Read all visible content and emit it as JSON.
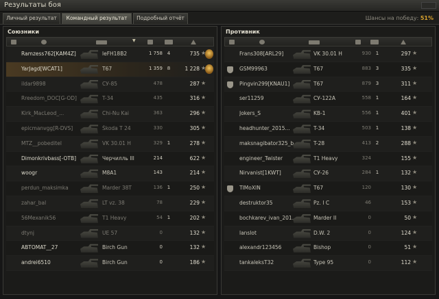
{
  "window": {
    "title": "Результаты боя"
  },
  "tabs": [
    {
      "label": "Личный результат",
      "active": false
    },
    {
      "label": "Командный результат",
      "active": true
    },
    {
      "label": "Подробный отчёт",
      "active": false
    }
  ],
  "win_chance": {
    "label": "Шансы на победу:",
    "value": "51%"
  },
  "allies": {
    "title": "Союзники",
    "rows": [
      {
        "name": "Ramzess762[KAM4Z]",
        "tank": "leFH18B2",
        "damage": "1 758",
        "kills": "4",
        "xp": "735",
        "medal": true,
        "alive": true,
        "me": false,
        "squad": false
      },
      {
        "name": "YarJagd[WCAT1]",
        "tank": "T67",
        "damage": "1 359",
        "kills": "8",
        "xp": "1 228",
        "medal": true,
        "alive": true,
        "me": true,
        "squad": false
      },
      {
        "name": "ildar9898",
        "tank": "СУ-85",
        "damage": "478",
        "kills": "",
        "xp": "287",
        "medal": false,
        "alive": false,
        "me": false,
        "squad": false
      },
      {
        "name": "Rreedom_DOC[G-OD]",
        "tank": "T-34",
        "damage": "435",
        "kills": "",
        "xp": "316",
        "medal": false,
        "alive": false,
        "me": false,
        "squad": false
      },
      {
        "name": "Kirk_MacLeod_...",
        "tank": "Chi-Nu Kai",
        "damage": "363",
        "kills": "",
        "xp": "296",
        "medal": false,
        "alive": false,
        "me": false,
        "squad": false
      },
      {
        "name": "epicmanvgg[R-DVS]",
        "tank": "Škoda T 24",
        "damage": "330",
        "kills": "",
        "xp": "305",
        "medal": false,
        "alive": false,
        "me": false,
        "squad": false
      },
      {
        "name": "MTZ__pobeditel",
        "tank": "VK 30.01 H",
        "damage": "329",
        "kills": "1",
        "xp": "278",
        "medal": false,
        "alive": false,
        "me": false,
        "squad": false
      },
      {
        "name": "Dimonkrivbass[-OTB]",
        "tank": "Черчилль III",
        "damage": "214",
        "kills": "",
        "xp": "622",
        "medal": false,
        "alive": true,
        "me": false,
        "squad": false
      },
      {
        "name": "woogr",
        "tank": "M8A1",
        "damage": "143",
        "kills": "",
        "xp": "214",
        "medal": false,
        "alive": true,
        "me": false,
        "squad": false
      },
      {
        "name": "perdun_maksimka",
        "tank": "Marder 38T",
        "damage": "136",
        "kills": "1",
        "xp": "250",
        "medal": false,
        "alive": false,
        "me": false,
        "squad": false
      },
      {
        "name": "zahar_bal",
        "tank": "LT vz. 38",
        "damage": "78",
        "kills": "",
        "xp": "229",
        "medal": false,
        "alive": false,
        "me": false,
        "squad": false
      },
      {
        "name": "56Mexanik56",
        "tank": "T1 Heavy",
        "damage": "54",
        "kills": "1",
        "xp": "202",
        "medal": false,
        "alive": false,
        "me": false,
        "squad": false
      },
      {
        "name": "dtynj",
        "tank": "UE 57",
        "damage": "0",
        "kills": "",
        "xp": "132",
        "medal": false,
        "alive": false,
        "me": false,
        "squad": false
      },
      {
        "name": "ABTOMAT__27",
        "tank": "Birch Gun",
        "damage": "0",
        "kills": "",
        "xp": "132",
        "medal": false,
        "alive": true,
        "me": false,
        "squad": false
      },
      {
        "name": "andrei6510",
        "tank": "Birch Gun",
        "damage": "0",
        "kills": "",
        "xp": "186",
        "medal": false,
        "alive": true,
        "me": false,
        "squad": false
      }
    ]
  },
  "enemies": {
    "title": "Противник",
    "rows": [
      {
        "name": "Frans308[ARL29]",
        "tank": "VK 30.01 H",
        "damage": "930",
        "kills": "1",
        "xp": "297",
        "squad": false
      },
      {
        "name": "GSM99963",
        "tank": "T67",
        "damage": "883",
        "kills": "3",
        "xp": "335",
        "squad": true
      },
      {
        "name": "Pingvin299[KNAU1]",
        "tank": "T67",
        "damage": "879",
        "kills": "3",
        "xp": "311",
        "squad": true
      },
      {
        "name": "ser11259",
        "tank": "СУ-122А",
        "damage": "558",
        "kills": "1",
        "xp": "164",
        "squad": false
      },
      {
        "name": "Jokers_S",
        "tank": "KB-1",
        "damage": "556",
        "kills": "1",
        "xp": "401",
        "squad": false
      },
      {
        "name": "headhunter_2015...",
        "tank": "T-34",
        "damage": "503",
        "kills": "1",
        "xp": "138",
        "squad": false
      },
      {
        "name": "maksnagibator325_b...",
        "tank": "T-28",
        "damage": "413",
        "kills": "2",
        "xp": "288",
        "squad": false
      },
      {
        "name": "engineer_Twister",
        "tank": "T1 Heavy",
        "damage": "324",
        "kills": "",
        "xp": "155",
        "squad": false
      },
      {
        "name": "Nirvanist[1KWT]",
        "tank": "СУ-26",
        "damage": "284",
        "kills": "1",
        "xp": "132",
        "squad": false
      },
      {
        "name": "TIMoXIN",
        "tank": "T67",
        "damage": "120",
        "kills": "",
        "xp": "130",
        "squad": true
      },
      {
        "name": "destruktor35",
        "tank": "Pz. I C",
        "damage": "46",
        "kills": "",
        "xp": "153",
        "squad": false
      },
      {
        "name": "bochkarev_ivan_201...",
        "tank": "Marder II",
        "damage": "0",
        "kills": "",
        "xp": "50",
        "squad": false
      },
      {
        "name": "lanslot",
        "tank": "D.W. 2",
        "damage": "0",
        "kills": "",
        "xp": "124",
        "squad": false
      },
      {
        "name": "alexandr123456",
        "tank": "Bishop",
        "damage": "0",
        "kills": "",
        "xp": "51",
        "squad": false
      },
      {
        "name": "tankaleksT32",
        "tank": "Type 95",
        "damage": "0",
        "kills": "",
        "xp": "112",
        "squad": false
      }
    ]
  },
  "header_icons": [
    "squad-icon",
    "player-icon",
    "tank-icon",
    "damage-icon",
    "kills-icon",
    "xp-icon"
  ],
  "colors": {
    "accent": "#d8a22e",
    "highlight_row": "#4a3a22",
    "background": "#161616"
  }
}
